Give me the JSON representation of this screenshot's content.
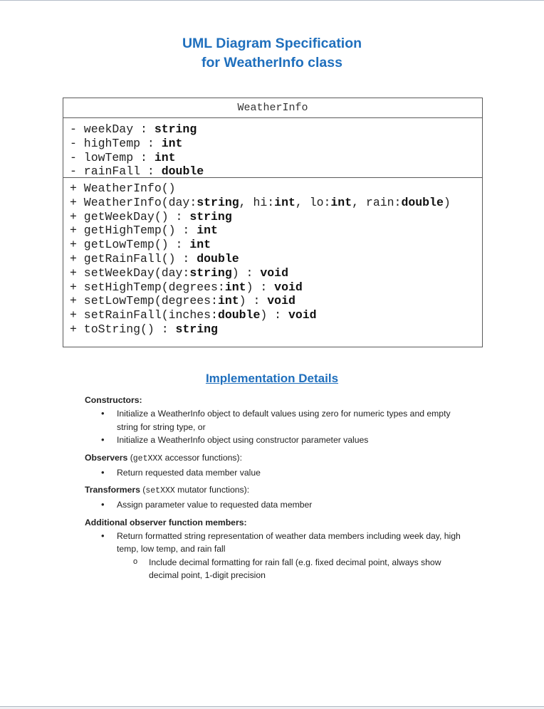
{
  "document": {
    "title_line1": "UML Diagram Specification",
    "title_line2": "for WeatherInfo class",
    "accent_color": "#1f6fbd"
  },
  "uml": {
    "class_name": "WeatherInfo",
    "attributes": [
      {
        "vis": "-",
        "name": "weekDay",
        "sep": " : ",
        "type": "string"
      },
      {
        "vis": "-",
        "name": "highTemp",
        "sep": " : ",
        "type": "int"
      },
      {
        "vis": "-",
        "name": "lowTemp",
        "sep": " : ",
        "type": "int"
      },
      {
        "vis": "-",
        "name": "rainFall",
        "sep": " : ",
        "type": "double"
      }
    ],
    "operations": [
      [
        {
          "t": "+ WeatherInfo()"
        }
      ],
      [
        {
          "t": "+ WeatherInfo(day:"
        },
        {
          "t": "string",
          "b": true
        },
        {
          "t": ", hi:"
        },
        {
          "t": "int",
          "b": true
        },
        {
          "t": ", lo:"
        },
        {
          "t": "int",
          "b": true
        },
        {
          "t": ", rain:"
        },
        {
          "t": "double",
          "b": true
        },
        {
          "t": ")"
        }
      ],
      [
        {
          "t": "+ getWeekDay() : "
        },
        {
          "t": "string",
          "b": true
        }
      ],
      [
        {
          "t": "+ getHighTemp() : "
        },
        {
          "t": "int",
          "b": true
        }
      ],
      [
        {
          "t": "+ getLowTemp() : "
        },
        {
          "t": "int",
          "b": true
        }
      ],
      [
        {
          "t": "+ getRainFall() : "
        },
        {
          "t": "double",
          "b": true
        }
      ],
      [
        {
          "t": "+ setWeekDay(day:"
        },
        {
          "t": "string",
          "b": true
        },
        {
          "t": ") : "
        },
        {
          "t": "void",
          "b": true
        }
      ],
      [
        {
          "t": "+ setHighTemp(degrees:"
        },
        {
          "t": "int",
          "b": true
        },
        {
          "t": ") : "
        },
        {
          "t": "void",
          "b": true
        }
      ],
      [
        {
          "t": "+ setLowTemp(degrees:"
        },
        {
          "t": "int",
          "b": true
        },
        {
          "t": ") : "
        },
        {
          "t": "void",
          "b": true
        }
      ],
      [
        {
          "t": "+ setRainFall(inches:"
        },
        {
          "t": "double",
          "b": true
        },
        {
          "t": ") : "
        },
        {
          "t": "void",
          "b": true
        }
      ],
      [
        {
          "t": "+ toString() : "
        },
        {
          "t": "string",
          "b": true
        }
      ]
    ]
  },
  "details": {
    "heading": "Implementation Details",
    "sections": [
      {
        "head": "Constructors:",
        "code": "",
        "tail": "",
        "items": [
          {
            "level": 1,
            "text": "Initialize a WeatherInfo object to default values using zero for numeric types and empty string for string type, or"
          },
          {
            "level": 1,
            "text": "Initialize a WeatherInfo object using constructor parameter values"
          }
        ]
      },
      {
        "head": "Observers",
        "pre": " (",
        "code": "getXXX",
        "tail": " accessor functions):",
        "items": [
          {
            "level": 1,
            "text": "Return requested data member value"
          }
        ]
      },
      {
        "head": "Transformers",
        "pre": " (",
        "code": "setXXX",
        "tail": " mutator functions):",
        "items": [
          {
            "level": 1,
            "text": "Assign parameter value to requested data member"
          }
        ]
      },
      {
        "head": "Additional observer function members:",
        "code": "",
        "tail": "",
        "items": [
          {
            "level": 1,
            "text": "Return formatted string representation of weather data members including week day, high temp, low temp, and rain fall"
          },
          {
            "level": 2,
            "text": "Include decimal formatting for rain fall (e.g. fixed decimal point, always show decimal point, 1-digit precision"
          }
        ]
      }
    ]
  }
}
